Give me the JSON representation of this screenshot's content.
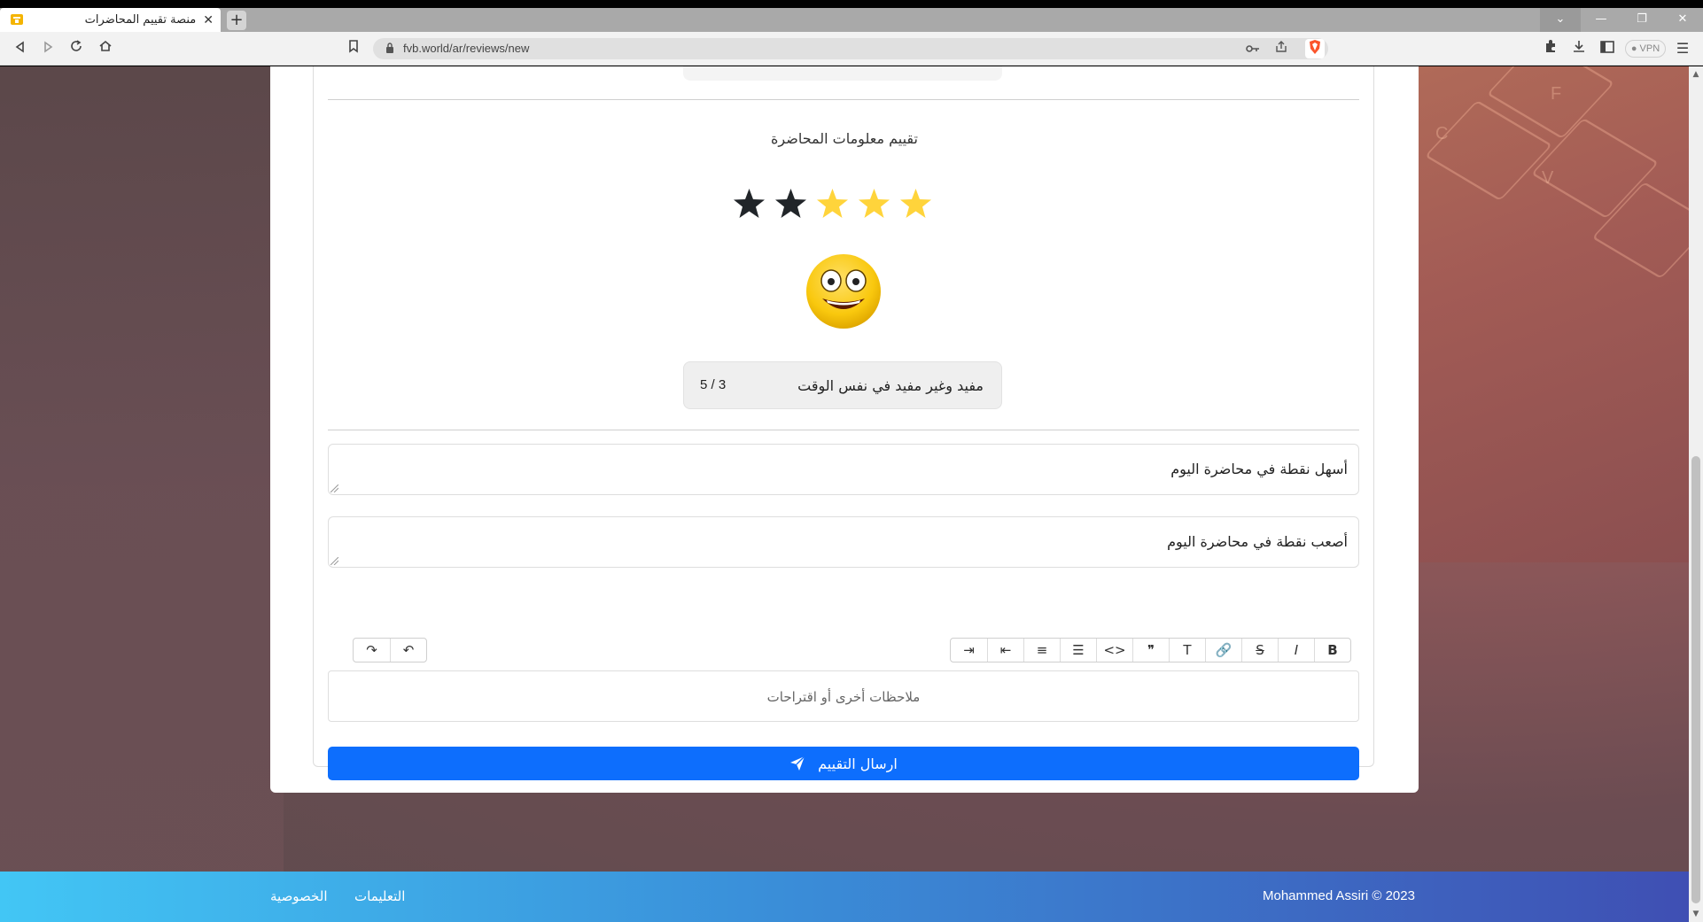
{
  "browser": {
    "tab_title": "منصة تقييم المحاضرات",
    "tab_close": "✕",
    "new_tab": "+",
    "url": "fvb.world/ar/reviews/new",
    "vpn_label": "VPN"
  },
  "review": {
    "section_title": "تقييم معلومات المحاضرة",
    "stars_total": 5,
    "rating_value": 3,
    "rating_label": "مفيد وغير مفيد في نفس الوقت",
    "rating_score": "3 / 5",
    "easiest_point_placeholder": "أسهل نقطة في محاضرة اليوم",
    "hardest_point_placeholder": "أصعب نقطة في محاضرة اليوم",
    "notes_placeholder": "ملاحظات أخرى أو اقتراحات",
    "submit_label": "ارسال التقييم"
  },
  "editor_tools": [
    {
      "name": "bold",
      "glyph": "B"
    },
    {
      "name": "italic",
      "glyph": "I"
    },
    {
      "name": "strikethrough",
      "glyph": "S"
    },
    {
      "name": "link",
      "glyph": "🔗"
    },
    {
      "name": "heading",
      "glyph": "T"
    },
    {
      "name": "quote",
      "glyph": "❞"
    },
    {
      "name": "code",
      "glyph": "<>"
    },
    {
      "name": "bullet-list",
      "glyph": "☰"
    },
    {
      "name": "numbered-list",
      "glyph": "≡"
    },
    {
      "name": "outdent",
      "glyph": "⇤"
    },
    {
      "name": "indent",
      "glyph": "⇥"
    }
  ],
  "history_tools": [
    {
      "name": "undo",
      "glyph": "↶"
    },
    {
      "name": "redo",
      "glyph": "↷"
    }
  ],
  "footer": {
    "privacy": "الخصوصية",
    "instructions": "التعليمات",
    "copyright": "Mohammed Assiri © 2023"
  },
  "colors": {
    "primary": "#0d6efd",
    "star_active": "#ffd43b",
    "star_inactive": "#212529"
  }
}
